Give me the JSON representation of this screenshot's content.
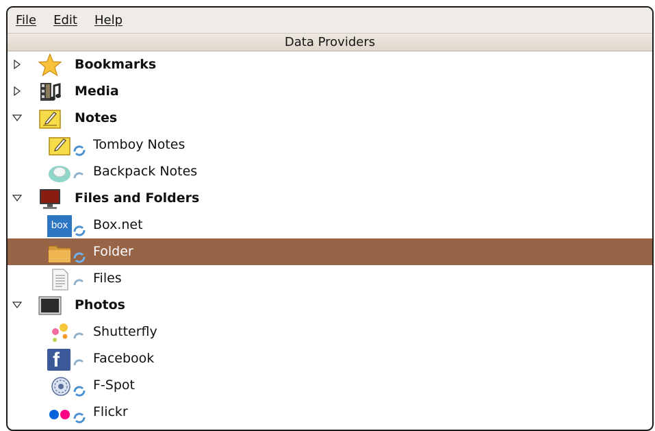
{
  "menu": [
    "File",
    "Edit",
    "Help"
  ],
  "column_header": "Data Providers",
  "tree": {
    "bookmarks": {
      "label": "Bookmarks",
      "expanded": false,
      "icon": "star-icon"
    },
    "media": {
      "label": "Media",
      "expanded": false,
      "icon": "film-music-icon"
    },
    "notes": {
      "label": "Notes",
      "expanded": true,
      "icon": "notepad-icon",
      "children": [
        {
          "label": "Tomboy Notes",
          "icon": "notepad-icon"
        },
        {
          "label": "Backpack Notes",
          "icon": "backpack-icon"
        }
      ]
    },
    "files_and_folders": {
      "label": "Files and Folders",
      "expanded": true,
      "icon": "monitor-icon",
      "children": [
        {
          "label": "Box.net",
          "icon": "box-logo-icon",
          "logo_text": "box"
        },
        {
          "label": "Folder",
          "icon": "folder-icon",
          "selected": true
        },
        {
          "label": "Files",
          "icon": "text-file-icon"
        }
      ]
    },
    "photos": {
      "label": "Photos",
      "expanded": true,
      "icon": "photo-frame-icon",
      "children": [
        {
          "label": "Shutterfly",
          "icon": "shutterfly-dots-icon"
        },
        {
          "label": "Facebook",
          "icon": "facebook-logo-icon",
          "logo_text": "f"
        },
        {
          "label": "F-Spot",
          "icon": "fspot-shutter-icon"
        },
        {
          "label": "Flickr",
          "icon": "flickr-dots-icon"
        }
      ]
    }
  },
  "colors": {
    "selection": "#976448",
    "sync_active": "#4a90d0",
    "sync_inactive": "#8fb1cc"
  }
}
